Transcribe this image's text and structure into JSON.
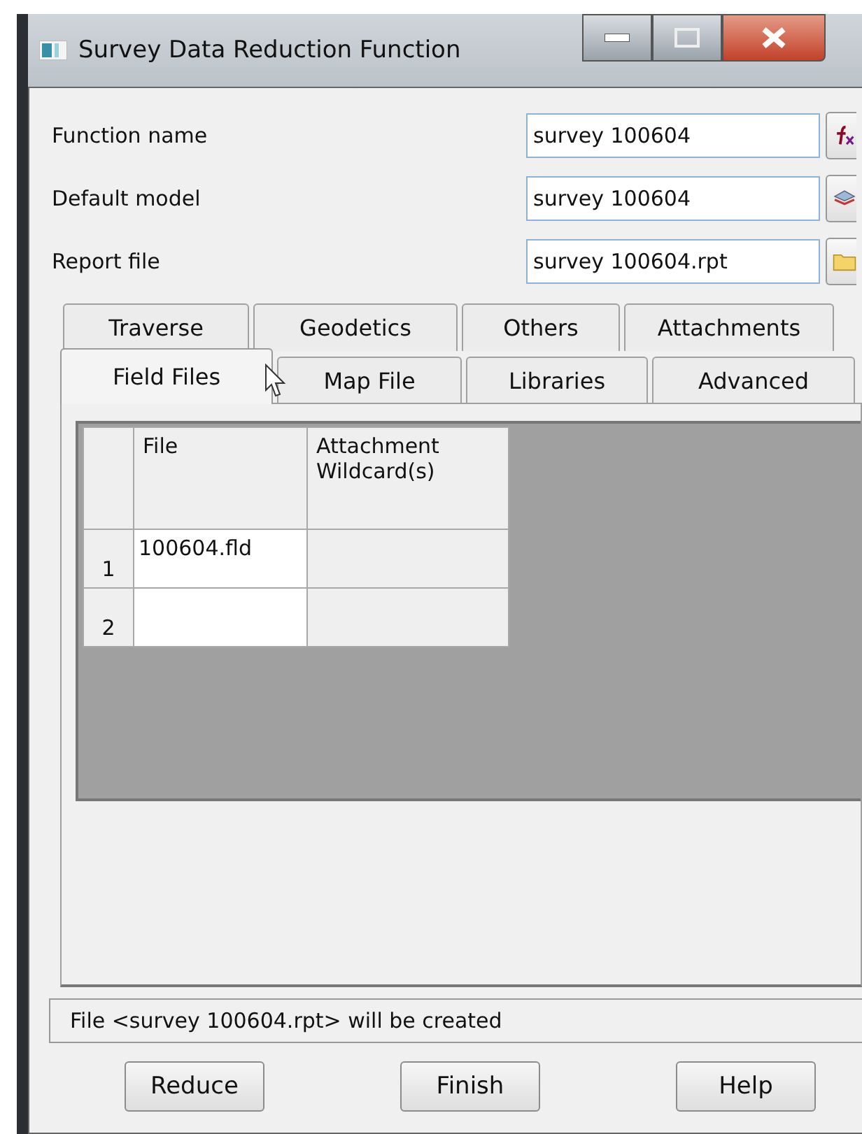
{
  "window": {
    "title": "Survey Data Reduction Function"
  },
  "fields": [
    {
      "label": "Function name",
      "value": "survey 100604",
      "kind": "function"
    },
    {
      "label": "Default model",
      "value": "survey 100604",
      "kind": "model"
    },
    {
      "label": "Report file",
      "value": "survey 100604.rpt",
      "kind": "file"
    }
  ],
  "tab_rows": [
    [
      {
        "label": "Traverse",
        "selected": false
      },
      {
        "label": "Geodetics",
        "selected": false
      },
      {
        "label": "Others",
        "selected": false
      },
      {
        "label": "Attachments",
        "selected": false
      }
    ],
    [
      {
        "label": "Field Files",
        "selected": true
      },
      {
        "label": "Map File",
        "selected": false
      },
      {
        "label": "Libraries",
        "selected": false
      },
      {
        "label": "Advanced",
        "selected": false
      }
    ]
  ],
  "table": {
    "columns": [
      "File",
      "Attachment Wildcard(s)"
    ],
    "rows": [
      {
        "number": "1",
        "file": "100604.fld"
      },
      {
        "number": "2"
      }
    ]
  },
  "status_bar": "File <survey 100604.rpt> will be created",
  "buttons": [
    "Reduce",
    "Finish",
    "Help"
  ]
}
